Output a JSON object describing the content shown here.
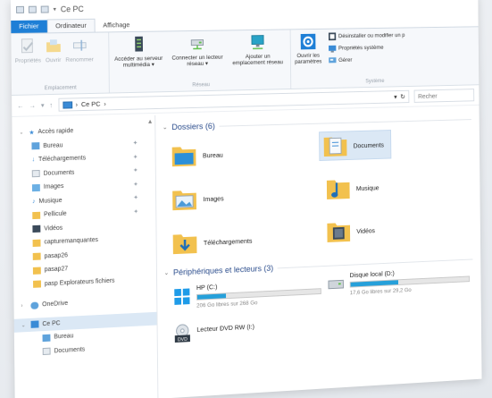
{
  "titlebar": {
    "title": "Ce PC"
  },
  "ribbon": {
    "tabs": [
      "Fichier",
      "Ordinateur",
      "Affichage"
    ],
    "groups": {
      "emplacement": {
        "label": "Emplacement",
        "buttons": [
          "Propriétés",
          "Ouvrir",
          "Renommer"
        ]
      },
      "reseau": {
        "label": "Réseau",
        "buttons": [
          "Accéder au serveur multimédia ▾",
          "Connecter un lecteur réseau ▾",
          "Ajouter un emplacement réseau"
        ]
      },
      "systeme": {
        "label": "Système",
        "big_button": "Ouvrir les paramètres",
        "items": [
          "Désinstaller ou modifier un p",
          "Propriétés système",
          "Gérer"
        ]
      }
    }
  },
  "address": {
    "path": "Ce PC",
    "search_placeholder": "Recher"
  },
  "nav": {
    "quick_access": "Accès rapide",
    "items": [
      "Bureau",
      "Téléchargements",
      "Documents",
      "Images",
      "Musique",
      "Pellicule",
      "Vidéos",
      "capturemanquantes",
      "pasap26",
      "pasap27",
      "pasp Explorateurs fichiers"
    ],
    "onedrive": "OneDrive",
    "this_pc": "Ce PC",
    "pc_children": [
      "Bureau",
      "Documents"
    ]
  },
  "main": {
    "folders_header": "Dossiers (6)",
    "folders": [
      "Bureau",
      "Documents",
      "Images",
      "Musique",
      "Téléchargements",
      "Vidéos"
    ],
    "drives_header": "Périphériques et lecteurs (3)",
    "drives": [
      {
        "name": "HP (C:)",
        "free": "206 Go libres sur 268 Go",
        "used_fraction": 0.23
      },
      {
        "name": "Disque local (D:)",
        "free": "17,6 Go libres sur 29,2 Go",
        "used_fraction": 0.4
      },
      {
        "name": "Lecteur DVD RW (I:)"
      }
    ]
  },
  "colors": {
    "accent": "#1e7fd6",
    "folder": "#f2c14e",
    "selection": "#dbe8f5",
    "drive_bar": "#26a0da"
  }
}
